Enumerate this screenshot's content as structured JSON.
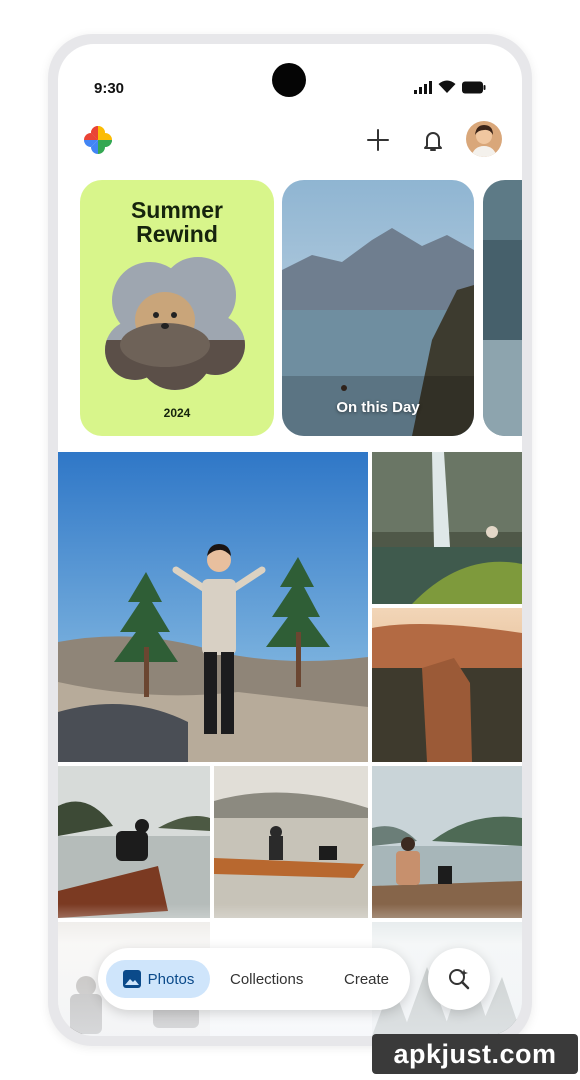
{
  "status_bar": {
    "time": "9:30",
    "icons": [
      "signal-icon",
      "wifi-icon",
      "battery-icon"
    ]
  },
  "top_bar": {
    "logo": "google-photos-pinwheel-icon",
    "actions": [
      "plus-icon",
      "bell-icon",
      "avatar"
    ]
  },
  "memories": [
    {
      "title": "Summer Rewind",
      "year": "2024"
    },
    {
      "label": "On this Day"
    }
  ],
  "bottom_nav": {
    "tabs": [
      {
        "label": "Photos",
        "icon": "photos-icon",
        "selected": true
      },
      {
        "label": "Collections",
        "selected": false
      },
      {
        "label": "Create",
        "selected": false
      }
    ],
    "search_icon": "search-sparkle-icon"
  },
  "watermark": "apkjust.com",
  "colors": {
    "summer_card": "#d8f58b",
    "selected_tab": "#cfe5fb",
    "selected_tab_text": "#0b4a8a"
  }
}
